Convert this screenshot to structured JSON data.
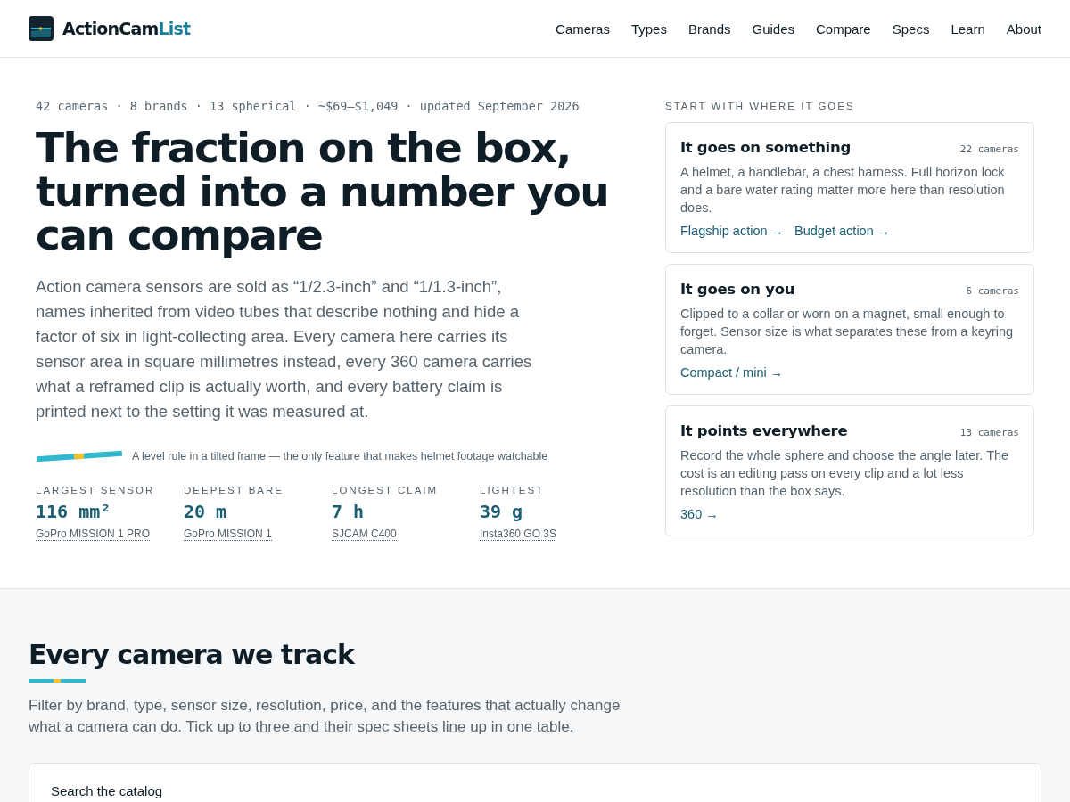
{
  "brand": {
    "main": "ActionCam",
    "accent": "List"
  },
  "nav": [
    {
      "label": "Cameras"
    },
    {
      "label": "Types"
    },
    {
      "label": "Brands"
    },
    {
      "label": "Guides"
    },
    {
      "label": "Compare"
    },
    {
      "label": "Specs"
    },
    {
      "label": "Learn"
    },
    {
      "label": "About"
    }
  ],
  "hero": {
    "meta": "42 cameras · 8 brands · 13 spherical · ~$69–$1,049 · updated September 2026",
    "title": "The fraction on the box, turned into a number you can compare",
    "lede": "Action camera sensors are sold as “1/2.3-inch” and “1/1.3-inch”, names inherited from video tubes that describe nothing and hide a factor of six in light-collecting area. Every camera here carries its sensor area in square millimetres instead, every 360 camera carries what a reframed clip is actually worth, and every battery claim is printed next to the setting it was measured at.",
    "level_caption": "A level rule in a tilted frame — the only feature that makes helmet footage watchable",
    "stats": [
      {
        "label": "LARGEST SENSOR",
        "value": "116 mm²",
        "camera": "GoPro MISSION 1 PRO"
      },
      {
        "label": "DEEPEST BARE",
        "value": "20 m",
        "camera": "GoPro MISSION 1"
      },
      {
        "label": "LONGEST CLAIM",
        "value": "7 h",
        "camera": "SJCAM C400"
      },
      {
        "label": "LIGHTEST",
        "value": "39 g",
        "camera": "Insta360 GO 3S"
      }
    ]
  },
  "start": {
    "heading": "START WITH WHERE IT GOES",
    "cards": [
      {
        "title": "It goes on something",
        "count": "22 cameras",
        "text": "A helmet, a handlebar, a chest harness. Full horizon lock and a bare water rating matter more here than resolution does.",
        "links": [
          "Flagship action →",
          "Budget action →"
        ]
      },
      {
        "title": "It goes on you",
        "count": "6 cameras",
        "text": "Clipped to a collar or worn on a magnet, small enough to forget. Sensor size is what separates these from a keyring camera.",
        "links": [
          "Compact / mini →"
        ]
      },
      {
        "title": "It points everywhere",
        "count": "13 cameras",
        "text": "Record the whole sphere and choose the angle later. The cost is an editing pass on every clip and a lot less resolution than the box says.",
        "links": [
          "360 →"
        ]
      }
    ]
  },
  "catalog": {
    "title": "Every camera we track",
    "text": "Filter by brand, type, sensor size, resolution, price, and the features that actually change what a camera can do. Tick up to three and their spec sheets line up in one table.",
    "search_label": "Search the catalog"
  }
}
